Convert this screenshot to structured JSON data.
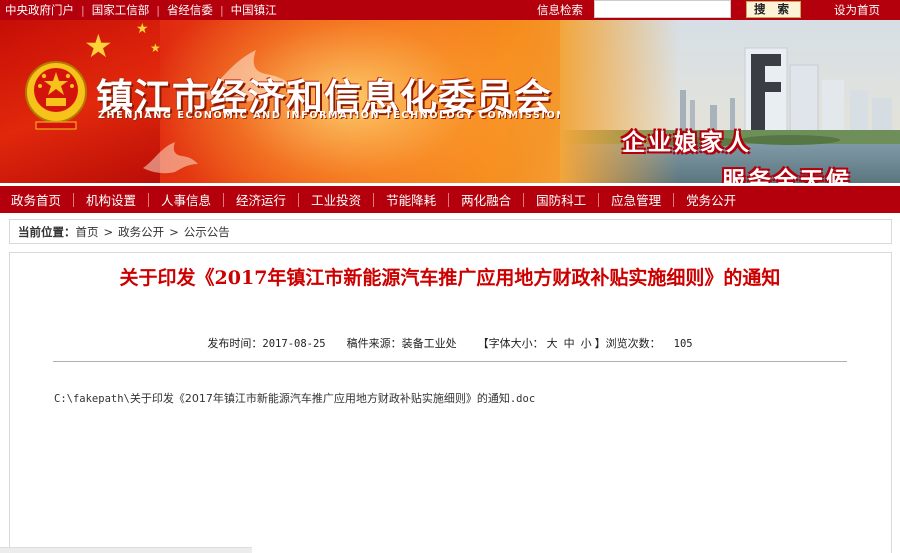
{
  "topbar": {
    "links": [
      "中央政府门户",
      "国家工信部",
      "省经信委",
      "中国镇江"
    ],
    "search_label": "信息检索",
    "search_value": "",
    "search_button": "搜 索",
    "set_homepage": "设为首页"
  },
  "banner": {
    "title_cn": "镇江市经济和信息化委员会",
    "title_en": "ZHENJIANG ECONOMIC AND INFORMATION TECHNOLOGY COMMISSION",
    "slogan_1": "企业娘家人",
    "slogan_2": "服务全天候"
  },
  "nav": {
    "items": [
      "政务首页",
      "机构设置",
      "人事信息",
      "经济运行",
      "工业投资",
      "节能降耗",
      "两化融合",
      "国防科工",
      "应急管理",
      "党务公开"
    ]
  },
  "breadcrumb": {
    "label": "当前位置：",
    "items": [
      "首页",
      "政务公开",
      "公示公告"
    ],
    "separator": ">"
  },
  "article": {
    "title": "关于印发《2017年镇江市新能源汽车推广应用地方财政补贴实施细则》的通知",
    "publish_label": "发布时间：",
    "publish_date": "2017-08-25",
    "source_label": "稿件来源：",
    "source_value": "装备工业处",
    "font_size_label": "【字体大小：",
    "font_sizes": [
      "大",
      "中",
      "小"
    ],
    "font_size_close": "】",
    "views_label": "浏览次数：",
    "views_value": "105",
    "attachment_path": "C:\\fakepath\\",
    "attachment_name": "关于印发《2017年镇江市新能源汽车推广应用地方财政补贴实施细则》的通知",
    "attachment_ext": ".doc"
  },
  "colors": {
    "brand_red": "#b4000c",
    "title_red": "#cc0000"
  }
}
